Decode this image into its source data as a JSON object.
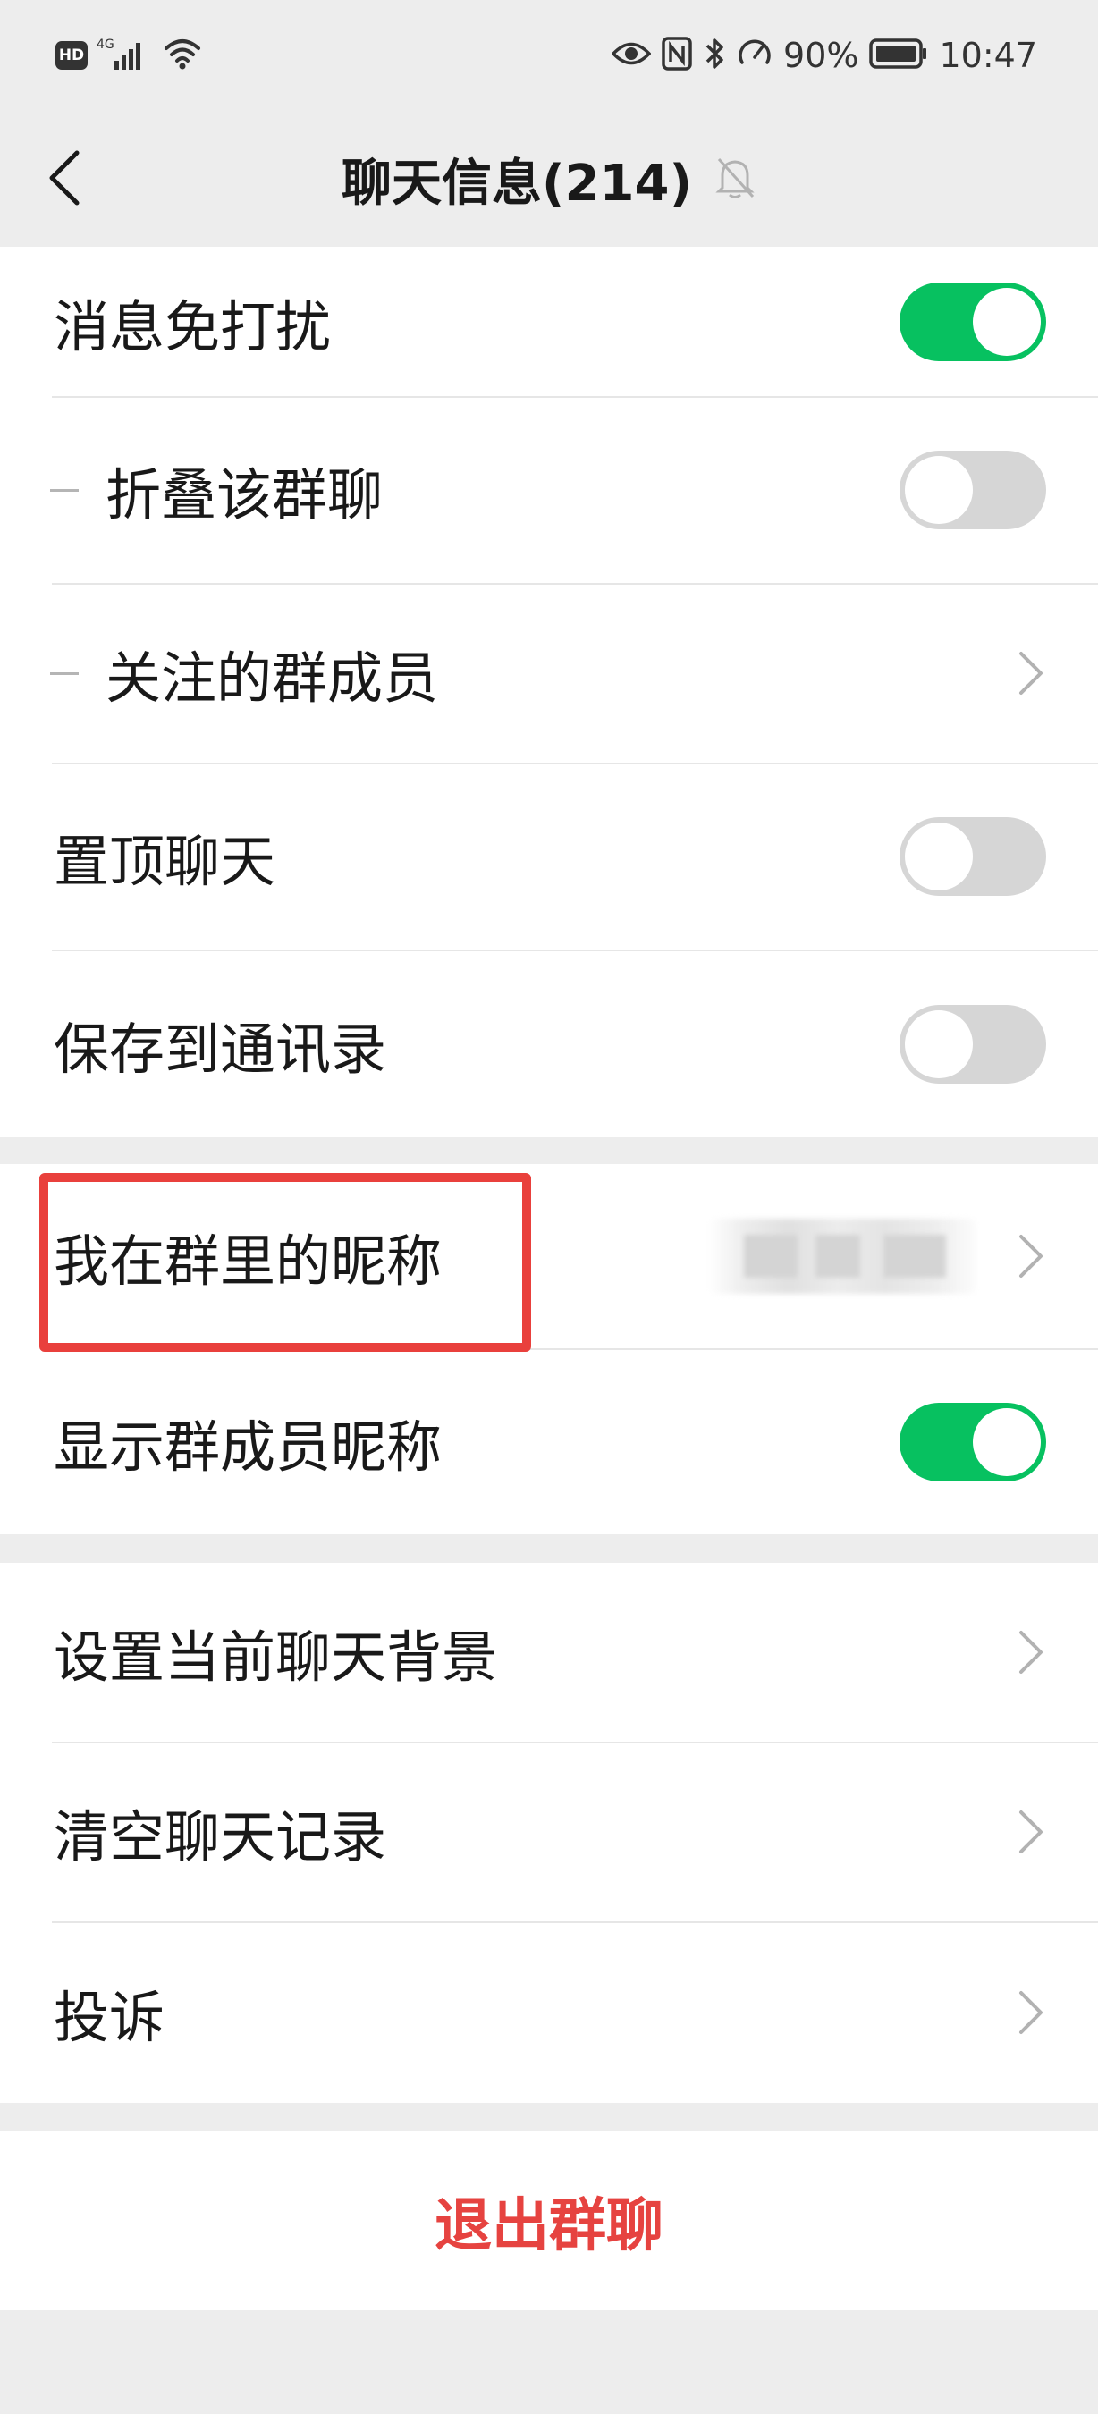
{
  "status_bar": {
    "network": "HD",
    "signal_label": "4G",
    "battery": "90%",
    "time": "10:47"
  },
  "header": {
    "title": "聊天信息(214)"
  },
  "settings_group_1": {
    "mute": {
      "label": "消息免打扰",
      "on": true
    },
    "fold_chat": {
      "label": "折叠该群聊",
      "on": false
    },
    "followed_members": {
      "label": "关注的群成员"
    },
    "pin_chat": {
      "label": "置顶聊天",
      "on": false
    },
    "save_to_contacts": {
      "label": "保存到通讯录",
      "on": false
    }
  },
  "settings_group_2": {
    "my_nickname": {
      "label": "我在群里的昵称"
    },
    "show_nicknames": {
      "label": "显示群成员昵称",
      "on": true
    }
  },
  "settings_group_3": {
    "chat_background": {
      "label": "设置当前聊天背景"
    },
    "clear_history": {
      "label": "清空聊天记录"
    },
    "report": {
      "label": "投诉"
    }
  },
  "exit_group": {
    "label": "退出群聊"
  },
  "colors": {
    "accent_green": "#07c160",
    "danger_red": "#e64340",
    "highlight_red": "#e9403c"
  }
}
